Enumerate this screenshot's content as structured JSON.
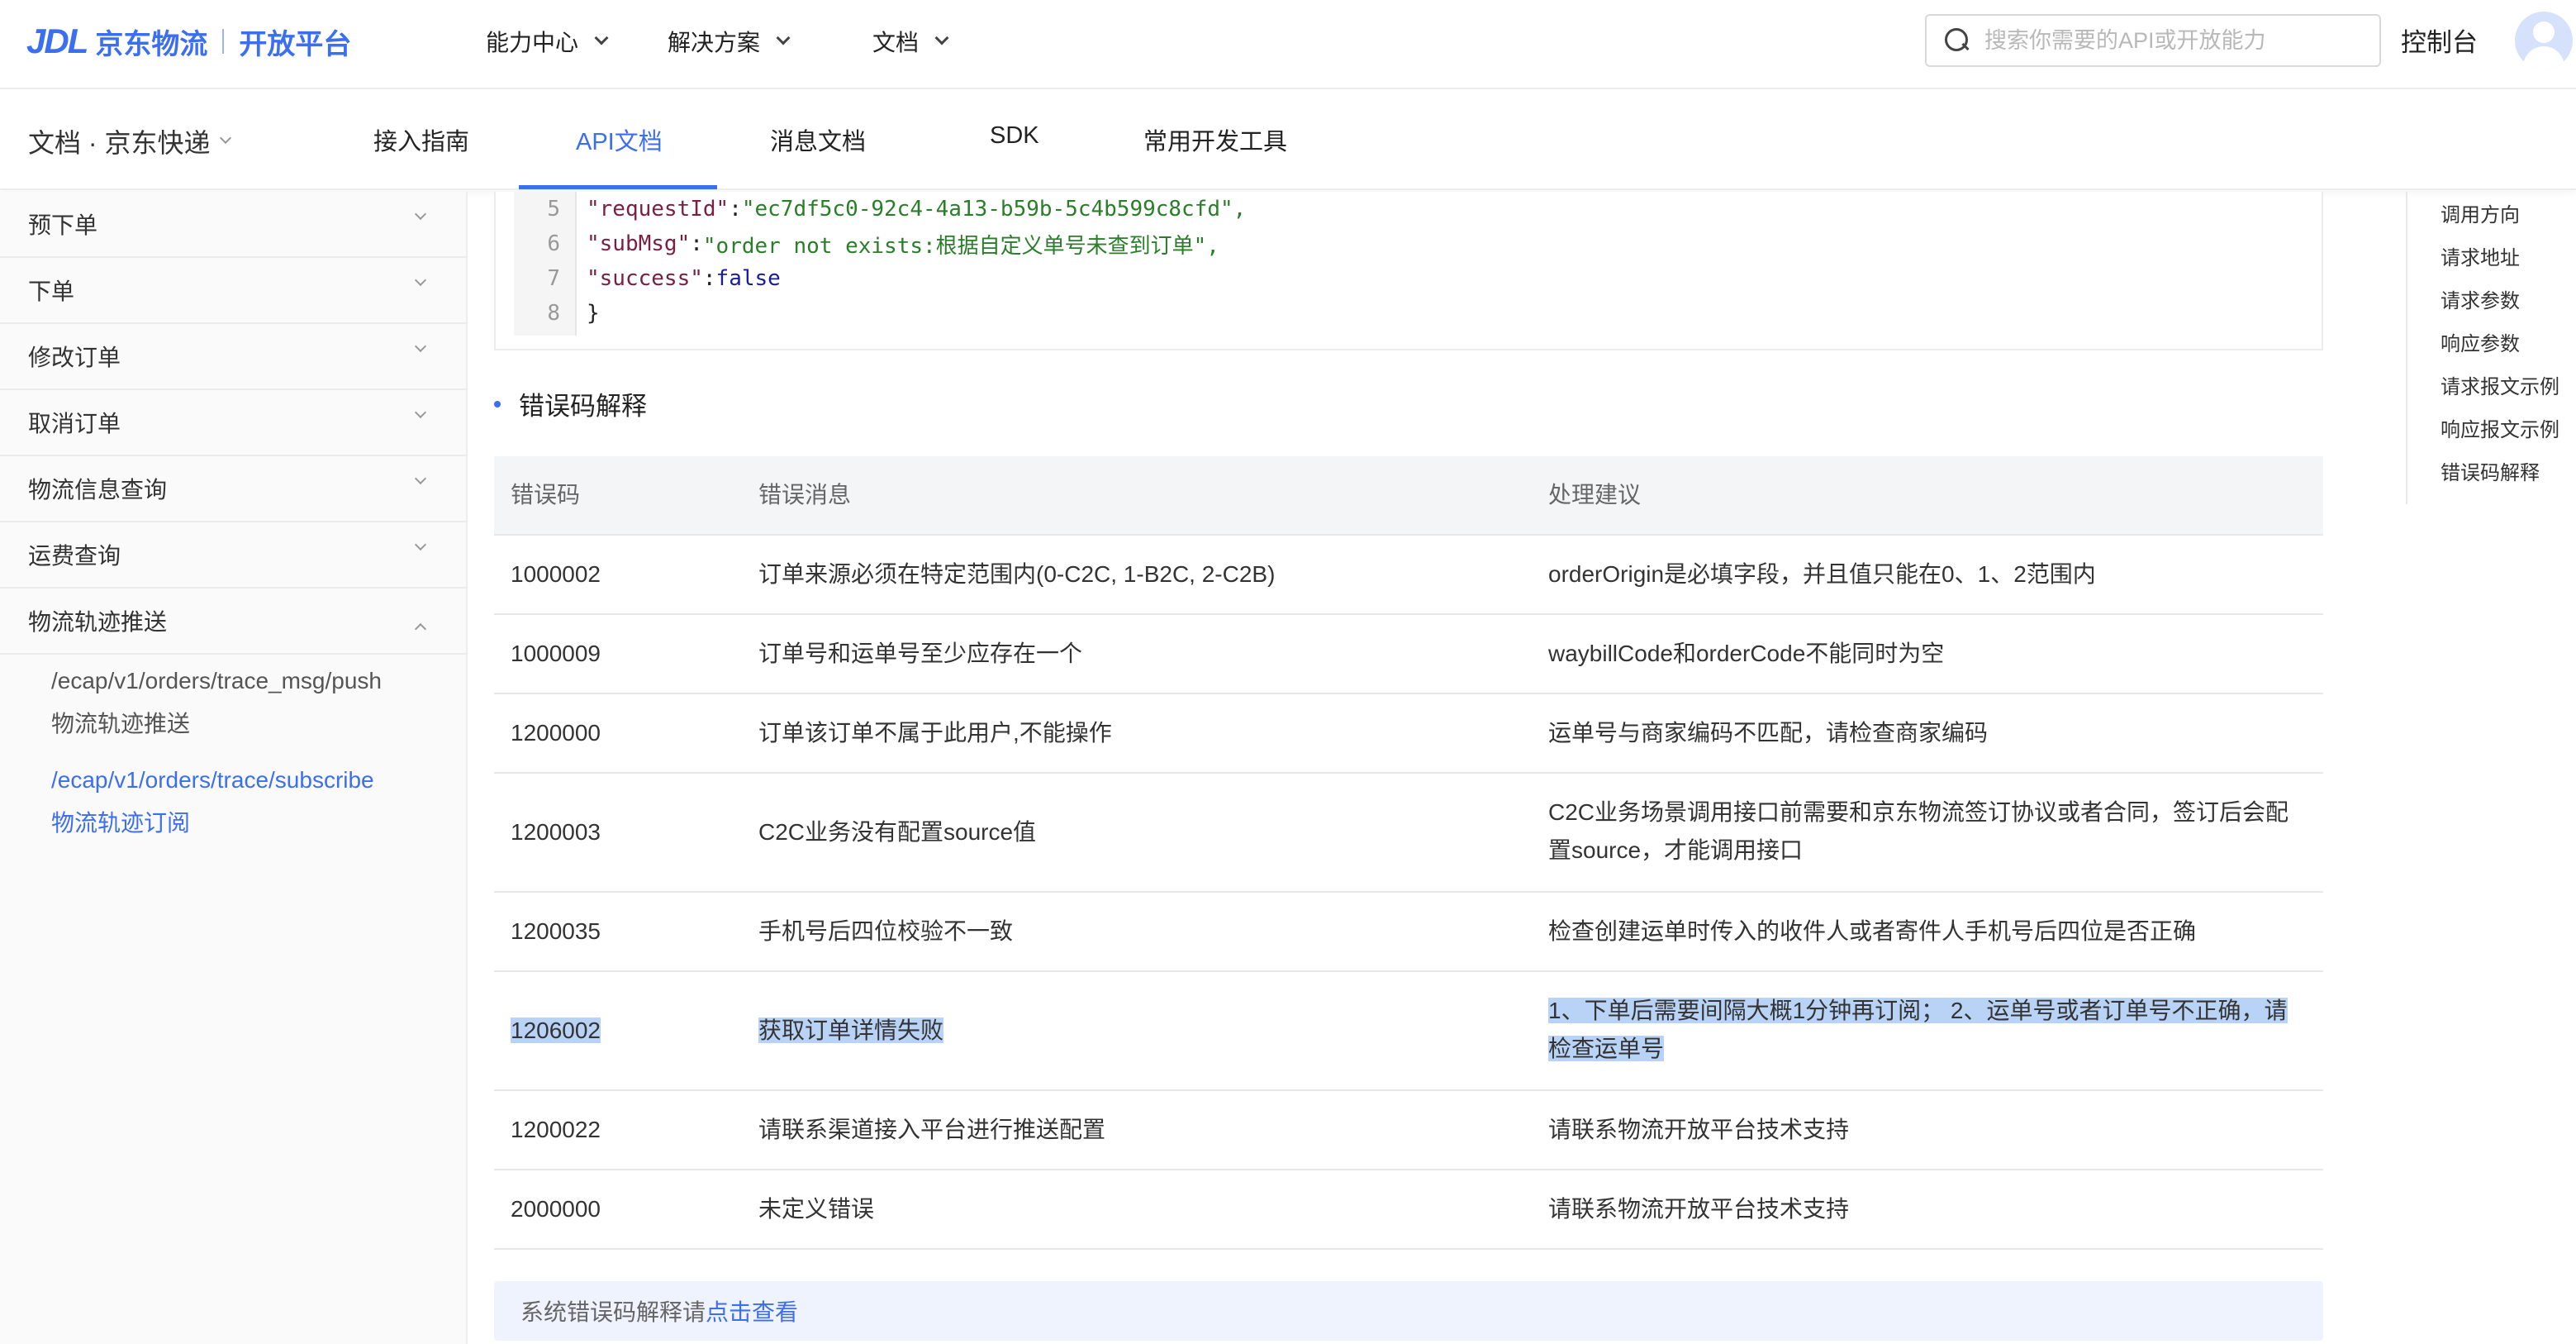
{
  "header": {
    "logo_mark": "JDL",
    "logo_name": "京东物流",
    "logo_platform": "开放平台",
    "nav": [
      {
        "label": "能力中心"
      },
      {
        "label": "解决方案"
      },
      {
        "label": "文档"
      }
    ],
    "search_placeholder": "搜索你需要的API或开放能力",
    "console_label": "控制台"
  },
  "subnav": {
    "doc_select": "文档 · 京东快递",
    "tabs": [
      {
        "label": "接入指南"
      },
      {
        "label": "API文档"
      },
      {
        "label": "消息文档"
      },
      {
        "label": "SDK"
      },
      {
        "label": "常用开发工具"
      }
    ],
    "active_tab": "API文档"
  },
  "sidebar": {
    "items": [
      {
        "label": "预下单"
      },
      {
        "label": "下单"
      },
      {
        "label": "修改订单"
      },
      {
        "label": "取消订单"
      },
      {
        "label": "物流信息查询"
      },
      {
        "label": "运费查询"
      },
      {
        "label": "物流轨迹推送"
      }
    ],
    "sub_items": [
      {
        "path": "/ecap/v1/orders/trace_msg/push",
        "name": "物流轨迹推送"
      },
      {
        "path": "/ecap/v1/orders/trace/subscribe",
        "name": "物流轨迹订阅"
      }
    ]
  },
  "code": {
    "lines": [
      {
        "num": "5",
        "key": "\"requestId\"",
        "value": "\"ec7df5c0-92c4-4a13-b59b-5c4b599c8cfd\","
      },
      {
        "num": "6",
        "key": "\"subMsg\"",
        "value": "\"order not exists:根据自定义单号未查到订单\","
      },
      {
        "num": "7",
        "key": "\"success\"",
        "value": "false"
      },
      {
        "num": "8",
        "close": "}"
      }
    ]
  },
  "errors": {
    "title": "错误码解释",
    "headers": [
      "错误码",
      "错误消息",
      "处理建议"
    ],
    "rows": [
      {
        "code": "1000002",
        "message": "订单来源必须在特定范围内(0-C2C, 1-B2C, 2-C2B)",
        "advice": "orderOrigin是必填字段，并且值只能在0、1、2范围内",
        "advice2": ""
      },
      {
        "code": "1000009",
        "message": "订单号和运单号至少应存在一个",
        "advice": "waybillCode和orderCode不能同时为空",
        "advice2": ""
      },
      {
        "code": "1200000",
        "message": "订单该订单不属于此用户,不能操作",
        "advice": "运单号与商家编码不匹配，请检查商家编码",
        "advice2": ""
      },
      {
        "code": "1200003",
        "message": "C2C业务没有配置source值",
        "advice": "C2C业务场景调用接口前需要和京东物流签订协议或者合同，签订后会配",
        "advice2": "置source，才能调用接口"
      },
      {
        "code": "1200035",
        "message": "手机号后四位校验不一致",
        "advice": "检查创建运单时传入的收件人或者寄件人手机号后四位是否正确",
        "advice2": ""
      },
      {
        "code": "1206002",
        "message": "获取订单详情失败",
        "advice": "1、下单后需要间隔大概1分钟再订阅； 2、运单号或者订单号不正确，请",
        "advice2": "检查运单号"
      },
      {
        "code": "1200022",
        "message": "请联系渠道接入平台进行推送配置",
        "advice": "请联系物流开放平台技术支持",
        "advice2": ""
      },
      {
        "code": "2000000",
        "message": "未定义错误",
        "advice": "请联系物流开放平台技术支持",
        "advice2": ""
      }
    ]
  },
  "footer_note": {
    "text": "系统错误码解释请",
    "link": "点击查看"
  },
  "anchors": [
    {
      "label": "调用方向"
    },
    {
      "label": "请求地址"
    },
    {
      "label": "请求参数"
    },
    {
      "label": "响应参数"
    },
    {
      "label": "请求报文示例"
    },
    {
      "label": "响应报文示例"
    },
    {
      "label": "错误码解释"
    }
  ],
  "colors": {
    "accent": "#3c6ef0",
    "selection": "#b8d3f6"
  }
}
